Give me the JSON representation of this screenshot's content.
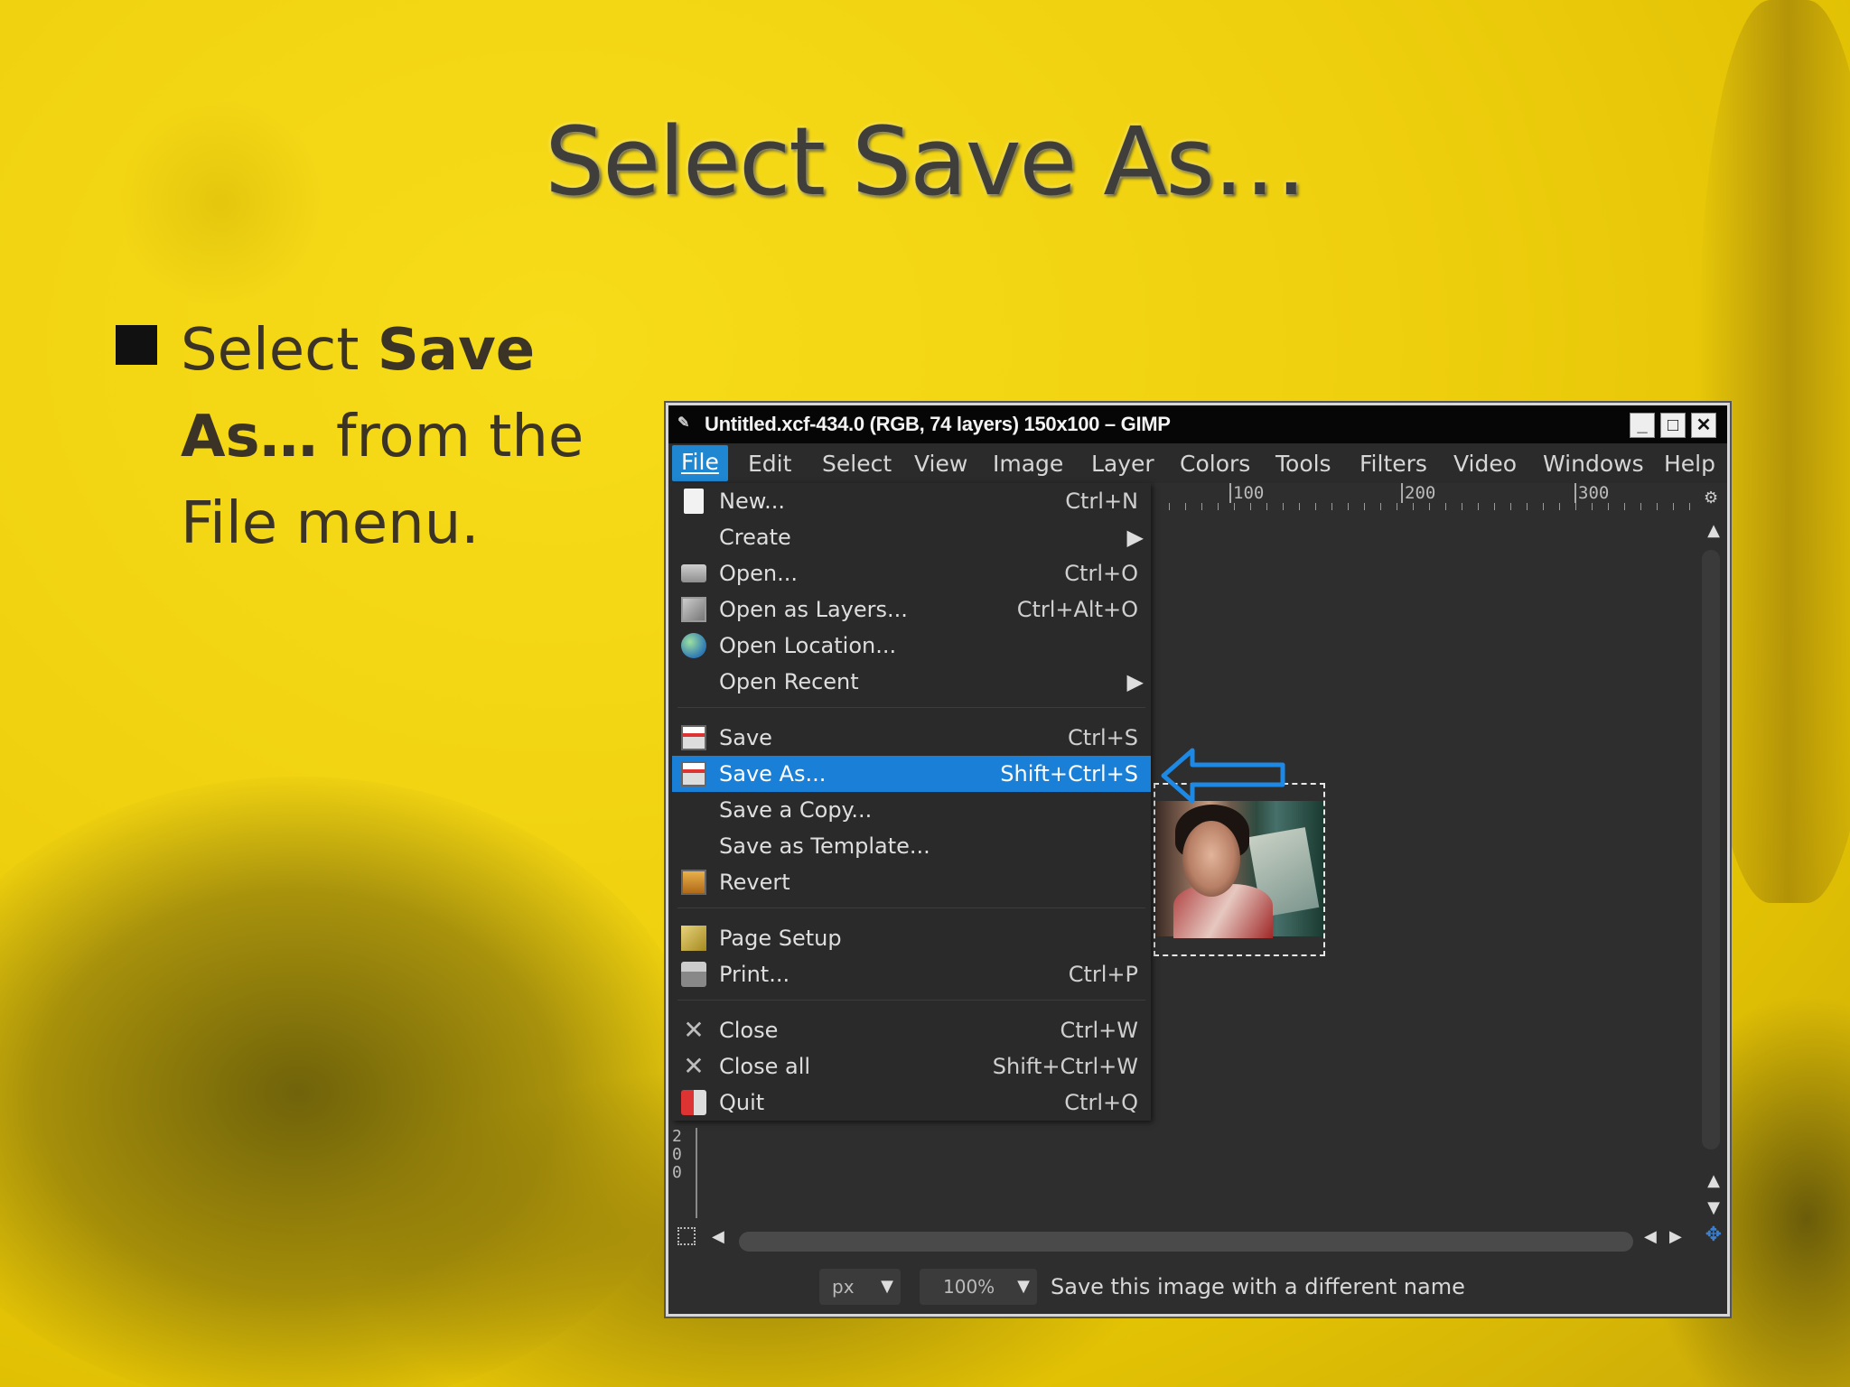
{
  "slide": {
    "title": "Select Save As…",
    "bullet": {
      "prefix": "Select ",
      "bold": "Save As…",
      "suffix": " from the File menu."
    }
  },
  "window": {
    "title": "Untitled.xcf-434.0 (RGB, 74 layers) 150x100 – GIMP",
    "buttons": {
      "minimize": "_",
      "maximize": "□",
      "close": "✕"
    }
  },
  "menubar": {
    "items": [
      "File",
      "Edit",
      "Select",
      "View",
      "Image",
      "Layer",
      "Colors",
      "Tools",
      "Filters",
      "Video",
      "Windows",
      "Help"
    ],
    "active": "File"
  },
  "ruler": {
    "top_labels": [
      "100",
      "200",
      "300"
    ],
    "left_labels": [
      "2",
      "0",
      "0"
    ]
  },
  "file_menu": {
    "items": [
      {
        "label": "New...",
        "shortcut": "Ctrl+N",
        "icon": "new-document-icon"
      },
      {
        "label": "Create",
        "submenu": "▶"
      },
      {
        "label": "Open...",
        "shortcut": "Ctrl+O",
        "icon": "open-folder-icon"
      },
      {
        "label": "Open as Layers...",
        "shortcut": "Ctrl+Alt+O",
        "icon": "open-layers-icon"
      },
      {
        "label": "Open Location...",
        "icon": "globe-icon"
      },
      {
        "label": "Open Recent",
        "submenu": "▶"
      },
      {
        "label": "Save",
        "shortcut": "Ctrl+S",
        "icon": "save-icon"
      },
      {
        "label": "Save As...",
        "shortcut": "Shift+Ctrl+S",
        "icon": "save-as-icon",
        "selected": true
      },
      {
        "label": "Save a Copy..."
      },
      {
        "label": "Save as Template..."
      },
      {
        "label": "Revert",
        "icon": "revert-icon"
      },
      {
        "label": "Page Setup",
        "icon": "page-setup-icon"
      },
      {
        "label": "Print...",
        "shortcut": "Ctrl+P",
        "icon": "print-icon"
      },
      {
        "label": "Close",
        "shortcut": "Ctrl+W",
        "icon": "close-x-icon"
      },
      {
        "label": "Close all",
        "shortcut": "Shift+Ctrl+W",
        "icon": "close-all-x-icon"
      },
      {
        "label": "Quit",
        "shortcut": "Ctrl+Q",
        "icon": "quit-icon"
      }
    ]
  },
  "statusbar": {
    "unit": "px",
    "zoom": "100%",
    "message": "Save this image with a different name"
  },
  "colors": {
    "highlight": "#1a7fd6",
    "menu_bg": "#2a2a2a",
    "slide_bg": "#efd00e"
  }
}
